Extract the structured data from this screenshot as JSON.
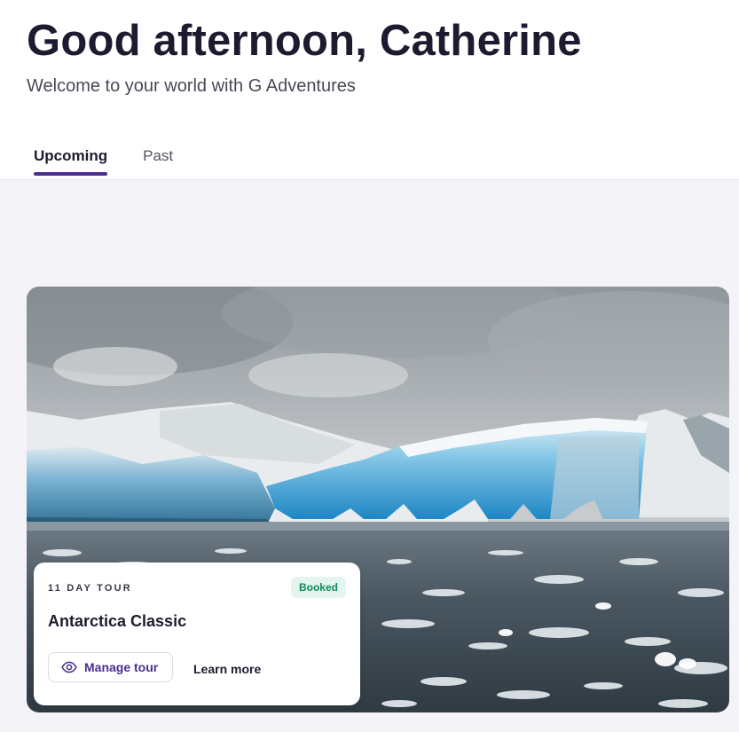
{
  "header": {
    "greeting": "Good afternoon, Catherine",
    "subtitle": "Welcome to your world with G Adventures"
  },
  "tabs": [
    {
      "label": "Upcoming",
      "active": true
    },
    {
      "label": "Past",
      "active": false
    }
  ],
  "tour": {
    "duration": "11 DAY TOUR",
    "status": "Booked",
    "name": "Antarctica Classic",
    "manage_label": "Manage tour",
    "learn_more_label": "Learn more",
    "image": "antarctic-iceberg-photo"
  },
  "colors": {
    "accent": "#4b2d8f",
    "booked_text": "#0f8a5a",
    "booked_bg": "#e3f6ee",
    "page_bg": "#f4f3f8"
  },
  "icons": {
    "manage": "eye-icon"
  }
}
